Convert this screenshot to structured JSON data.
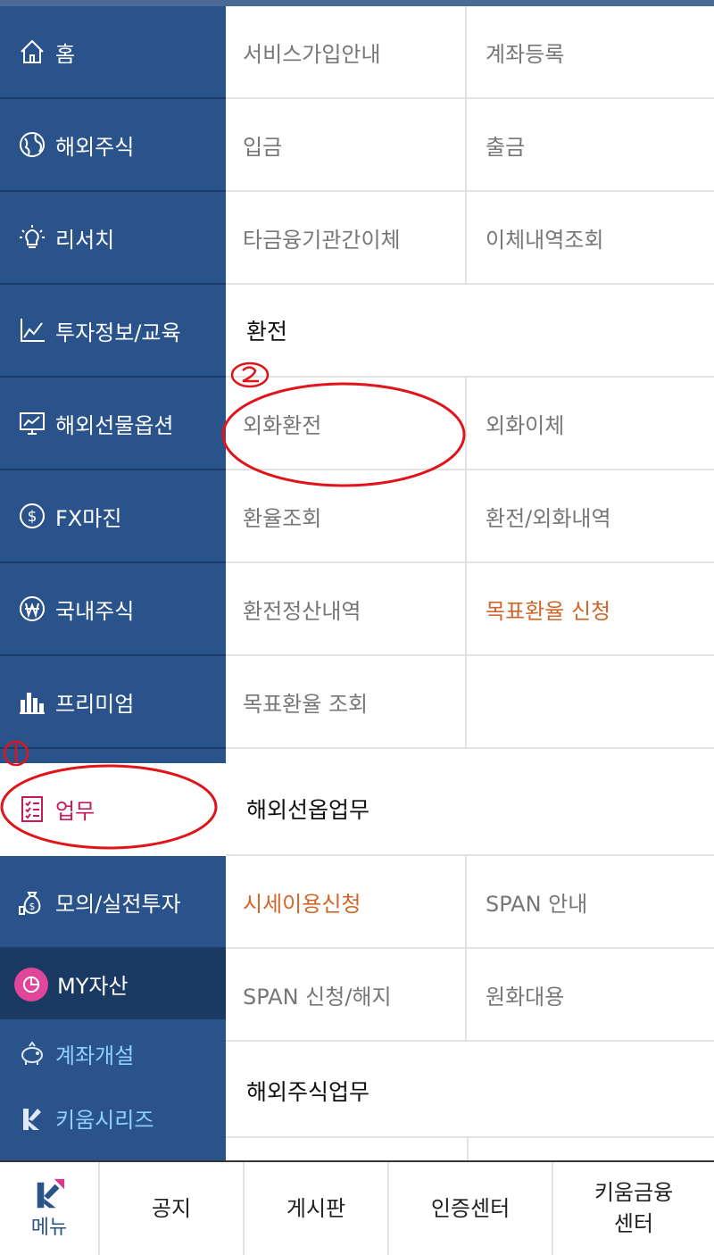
{
  "sidebar": {
    "items": [
      {
        "label": "홈",
        "icon": "home-icon"
      },
      {
        "label": "해외주식",
        "icon": "globe-icon"
      },
      {
        "label": "리서치",
        "icon": "lightbulb-icon"
      },
      {
        "label": "투자정보/교육",
        "icon": "line-chart-icon"
      },
      {
        "label": "해외선물옵션",
        "icon": "monitor-chart-icon"
      },
      {
        "label": "FX마진",
        "icon": "dollar-coin-icon"
      },
      {
        "label": "국내주식",
        "icon": "won-coin-icon"
      },
      {
        "label": "프리미엄",
        "icon": "bar-chart-icon"
      },
      {
        "label": "업무",
        "icon": "clipboard-list-icon"
      },
      {
        "label": "모의/실전투자",
        "icon": "money-bag-icon"
      }
    ],
    "my_asset": "MY자산",
    "open_account": "계좌개설",
    "kiwoom_series": "키움시리즈"
  },
  "content": {
    "rows": [
      {
        "left": "서비스가입안내",
        "right": "계좌등록"
      },
      {
        "left": "입금",
        "right": "출금"
      },
      {
        "left": "타금융기관간이체",
        "right": "이체내역조회"
      }
    ],
    "section_exchange": "환전",
    "exchange_rows": [
      {
        "left": "외화환전",
        "right": "외화이체"
      },
      {
        "left": "환율조회",
        "right": "환전/외화내역"
      },
      {
        "left": "환전정산내역",
        "right": "목표환율 신청"
      },
      {
        "left": "목표환율 조회",
        "right": ""
      }
    ],
    "section_futures": "해외선옵업무",
    "futures_rows": [
      {
        "left": "시세이용신청",
        "right": "SPAN 안내"
      },
      {
        "left": "SPAN 신청/해지",
        "right": "원화대용"
      }
    ],
    "section_stock": "해외주식업무"
  },
  "bottom": {
    "menu": "메뉴",
    "notice": "공지",
    "board": "게시판",
    "cert": "인증센터",
    "finance_line1": "키움금융",
    "finance_line2": "센터"
  },
  "colors": {
    "sidebar": "#2b538b",
    "active_text": "#c6185a",
    "orange_text": "#d2662a",
    "annotation": "#e0141b"
  }
}
